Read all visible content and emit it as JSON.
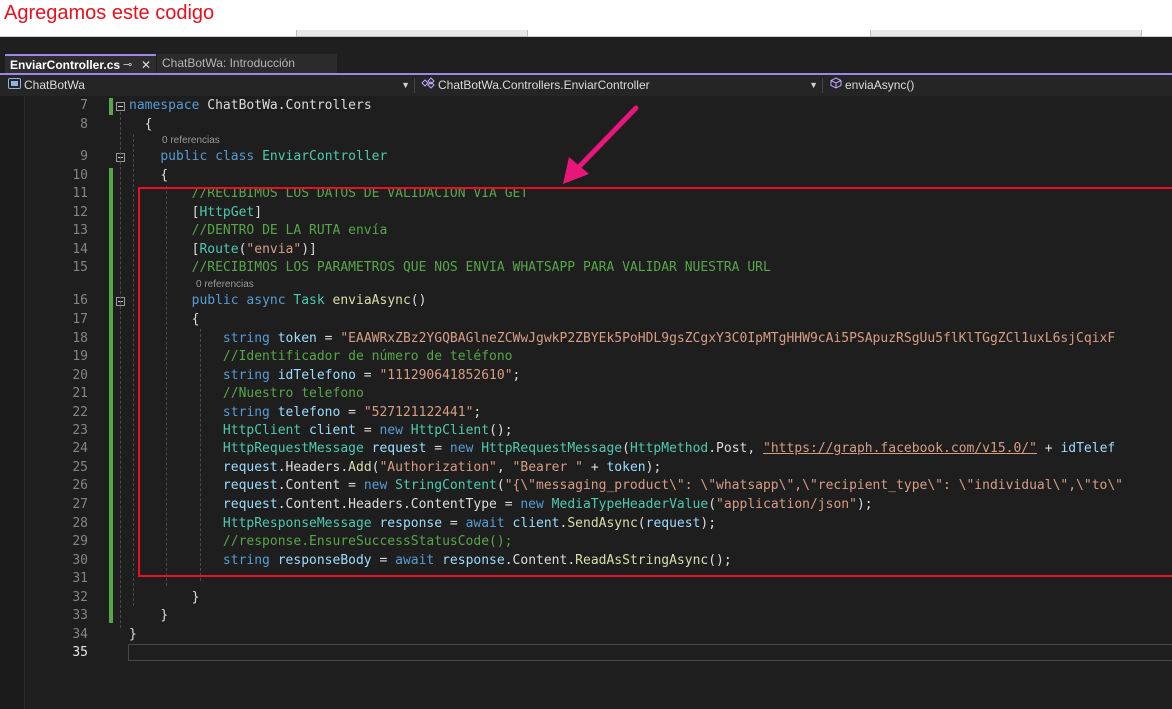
{
  "banner": {
    "text": "Agregamos este codigo"
  },
  "tabs": [
    {
      "label": "EnviarController.cs",
      "pin": "⊸",
      "close": "✕"
    },
    {
      "label": "ChatBotWa: Introducción"
    }
  ],
  "navbar": {
    "project": "ChatBotWa",
    "class": "ChatBotWa.Controllers.EnviarController",
    "member": "enviaAsync()"
  },
  "codelens": {
    "references": "0 referencias"
  },
  "code": {
    "line_numbers": [
      "7",
      "8",
      "9",
      "10",
      "11",
      "12",
      "13",
      "14",
      "15",
      "16",
      "17",
      "18",
      "19",
      "20",
      "21",
      "22",
      "23",
      "24",
      "25",
      "26",
      "27",
      "28",
      "29",
      "30",
      "31",
      "32",
      "33",
      "34",
      "35"
    ],
    "l7": {
      "kw": "namespace",
      "name": " ChatBotWa.Controllers"
    },
    "l8": "{",
    "l9": {
      "kw1": "public",
      "kw2": " class",
      "type": " EnviarController"
    },
    "l10": "{",
    "l11": "//RECIBIMOS LOS DATOS DE VALIDACION VIA GET",
    "l12": {
      "open": "[",
      "attr": "HttpGet",
      "close": "]"
    },
    "l13": "//DENTRO DE LA RUTA envía",
    "l14": {
      "open": "[",
      "attr": "Route",
      "p1": "(",
      "str": "\"envia\"",
      "p2": ")]"
    },
    "l15": "//RECIBIMOS LOS PARAMETROS QUE NOS ENVIA WHATSAPP PARA VALIDAR NUESTRA URL",
    "l16": {
      "kw1": "public",
      "kw2": " async",
      "type": " Task",
      "method": " enviaAsync",
      "rest": "()"
    },
    "l17": "{",
    "l18": {
      "kw": "string",
      "var": " token",
      "op": " = ",
      "str": "\"EAAWRxZBz2YGQBAGlneZCWwJgwkP2ZBYEk5PoHDL9gsZCgxY3C0IpMTgHHW9cAi5PSApuzRSgUu5flKlTGgZCl1uxL6sjCqixF"
    },
    "l19": "//Identificador de número de teléfono",
    "l20": {
      "kw": "string",
      "var": " idTelefono",
      "op": " = ",
      "str": "\"111290641852610\"",
      "end": ";"
    },
    "l21": "//Nuestro telefono",
    "l22": {
      "kw": "string",
      "var": " telefono",
      "op": " = ",
      "str": "\"527121122441\"",
      "end": ";"
    },
    "l23": {
      "type": "HttpClient",
      "var": " client",
      "op": " = ",
      "kw": "new",
      "type2": " HttpClient",
      "end": "();"
    },
    "l24": {
      "type": "HttpRequestMessage",
      "var": " request",
      "op": " = ",
      "kw": "new",
      "type2": " HttpRequestMessage",
      "p1": "(",
      "type3": "HttpMethod",
      "p2": ".Post, ",
      "link": "\"https://graph.facebook.com/v15.0/\"",
      "p3": " + ",
      "var2": "idTelef"
    },
    "l25": {
      "var": "request",
      "p1": ".Headers.",
      "method": "Add",
      "p2": "(",
      "str1": "\"Authorization\"",
      "p3": ", ",
      "str2": "\"Bearer \"",
      "p4": " + ",
      "var2": "token",
      "end": ");"
    },
    "l26": {
      "var": "request",
      "p1": ".Content = ",
      "kw": "new",
      "type": " StringContent",
      "p2": "(",
      "str": "\"{\\\"messaging_product\\\": \\\"whatsapp\\\",\\\"recipient_type\\\": \\\"individual\\\",\\\"to\\\""
    },
    "l27": {
      "var": "request",
      "p1": ".Content.Headers.ContentType = ",
      "kw": "new",
      "type": " MediaTypeHeaderValue",
      "p2": "(",
      "str": "\"application/json\"",
      "end": ");"
    },
    "l28": {
      "type": "HttpResponseMessage",
      "var": " response",
      "op": " = ",
      "kw": "await",
      "var2": " client",
      "p1": ".",
      "method": "SendAsync",
      "p2": "(",
      "var3": "request",
      "end": ");"
    },
    "l29": "//response.EnsureSuccessStatusCode();",
    "l30": {
      "kw": "string",
      "var": " responseBody",
      "op": " = ",
      "kw2": "await",
      "var2": " response",
      "p1": ".Content.",
      "method": "ReadAsStringAsync",
      "end": "();"
    },
    "l32": "}",
    "l33": "}",
    "l34": "}"
  },
  "annotation": {
    "color": "#e8157a"
  }
}
